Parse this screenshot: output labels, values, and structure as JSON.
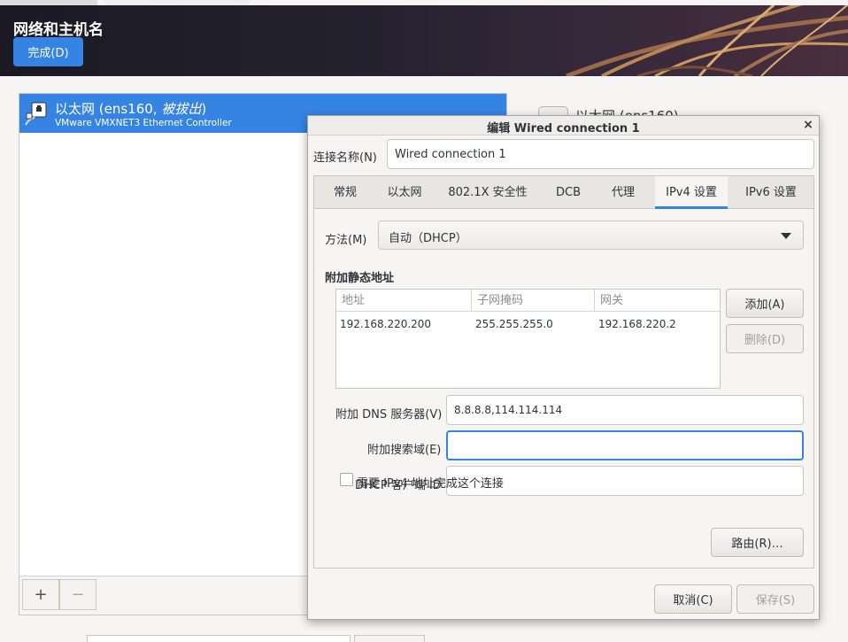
{
  "header": {
    "title": "网络和主机名",
    "done_label": "完成(D)"
  },
  "devices": {
    "items": [
      {
        "name": "以太网 (ens160, ",
        "state": "被拔出",
        "name_close": ")",
        "description": "VMware VMXNET3 Ethernet Controller"
      }
    ],
    "add_label": "+",
    "remove_label": "−"
  },
  "background_right": {
    "device_title": "以太网 (ens160)"
  },
  "dialog": {
    "title": "编辑 Wired connection 1",
    "close_label": "×",
    "connection_name_label": "连接名称(N)",
    "connection_name_value": "Wired connection 1",
    "tabs": [
      {
        "label": "常规"
      },
      {
        "label": "以太网"
      },
      {
        "label": "802.1X 安全性"
      },
      {
        "label": "DCB"
      },
      {
        "label": "代理"
      },
      {
        "label": "IPv4 设置",
        "active": true
      },
      {
        "label": "IPv6 设置"
      }
    ],
    "ipv4": {
      "method_label": "方法(M)",
      "method_value": "自动（DHCP）",
      "static_section_title": "附加静态地址",
      "columns": [
        "地址",
        "子网掩码",
        "网关"
      ],
      "rows": [
        [
          "192.168.220.200",
          "255.255.255.0",
          "192.168.220.2"
        ]
      ],
      "add_label": "添加(A)",
      "delete_label": "删除(D)",
      "dns_label": "附加 DNS 服务器(V)",
      "dns_value": "8.8.8.8,114.114.114",
      "search_label": "附加搜索域(E)",
      "search_value": "",
      "dhcp_id_label": "DHCP 客户端 ID",
      "dhcp_id_value": "",
      "require_label": "需要 IPv4 地址完成这个连接",
      "require_checked": false,
      "routes_label": "路由(R)…"
    },
    "cancel_label": "取消(C)",
    "save_label": "保存(S)"
  },
  "colors": {
    "accent": "#3584e4",
    "window_bg": "#f6f5f4",
    "text": "#2e3436"
  }
}
